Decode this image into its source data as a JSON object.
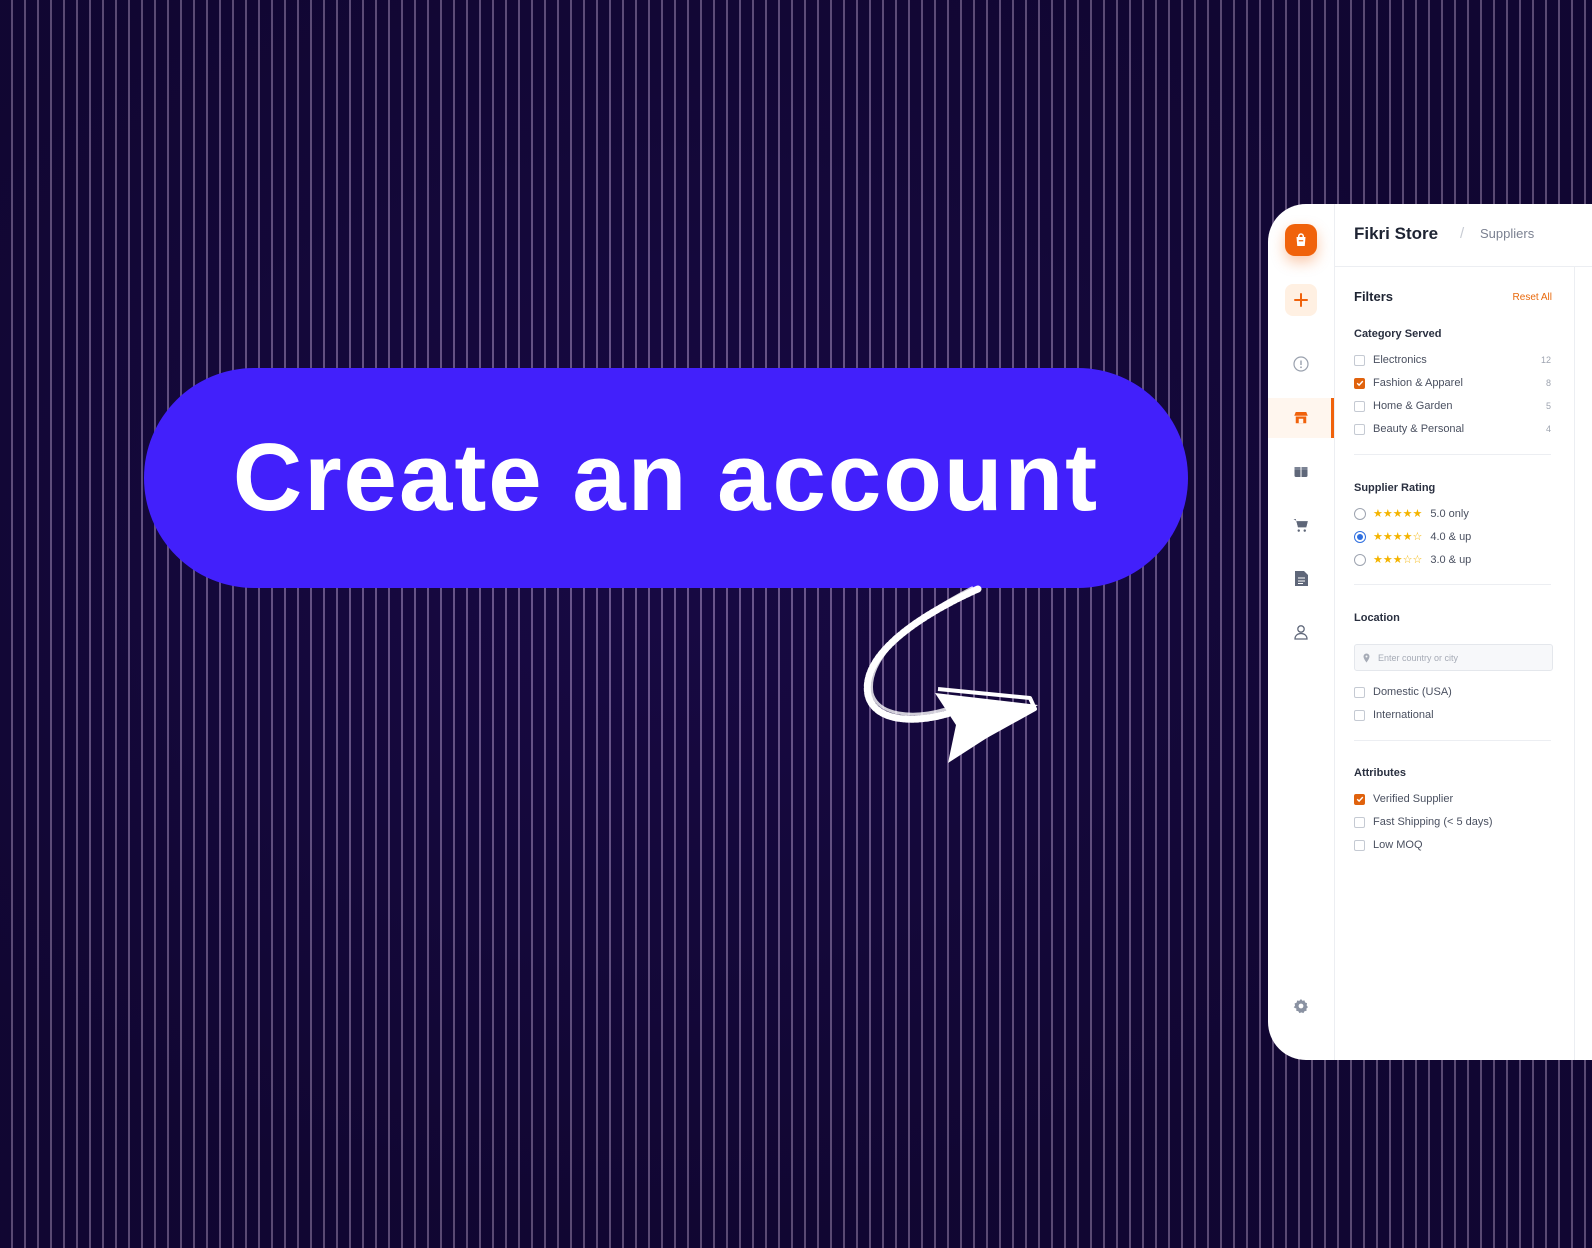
{
  "hero": {
    "cta_label": "Create an account"
  },
  "app": {
    "store_name": "Fikri Store",
    "breadcrumb_separator": "/",
    "breadcrumb_current": "Suppliers",
    "accent_color": "#f0620b"
  },
  "filters": {
    "title": "Filters",
    "reset_label": "Reset All",
    "category": {
      "title": "Category Served",
      "items": [
        {
          "label": "Electronics",
          "count": "12",
          "checked": false
        },
        {
          "label": "Fashion & Apparel",
          "count": "8",
          "checked": true
        },
        {
          "label": "Home & Garden",
          "count": "5",
          "checked": false
        },
        {
          "label": "Beauty & Personal",
          "count": "4",
          "checked": false
        }
      ]
    },
    "rating": {
      "title": "Supplier Rating",
      "options": [
        {
          "label": "5.0 only",
          "stars": 5,
          "selected": false
        },
        {
          "label": "4.0 & up",
          "stars": 4,
          "selected": true
        },
        {
          "label": "3.0 & up",
          "stars": 3,
          "selected": false
        }
      ]
    },
    "location": {
      "title": "Location",
      "placeholder": "Enter country or city",
      "value": "",
      "items": [
        {
          "label": "Domestic (USA)",
          "checked": false
        },
        {
          "label": "International",
          "checked": false
        }
      ]
    },
    "attributes": {
      "title": "Attributes",
      "items": [
        {
          "label": "Verified Supplier",
          "checked": true
        },
        {
          "label": "Fast Shipping (< 5 days)",
          "checked": false
        },
        {
          "label": "Low MOQ",
          "checked": false
        }
      ]
    }
  },
  "sidebar": {
    "icons": [
      "shopping-bag-icon",
      "plus-icon",
      "alert-circle-icon",
      "store-icon",
      "package-icon",
      "cart-icon",
      "document-icon",
      "user-icon",
      "settings-icon"
    ],
    "active": "store-icon"
  }
}
